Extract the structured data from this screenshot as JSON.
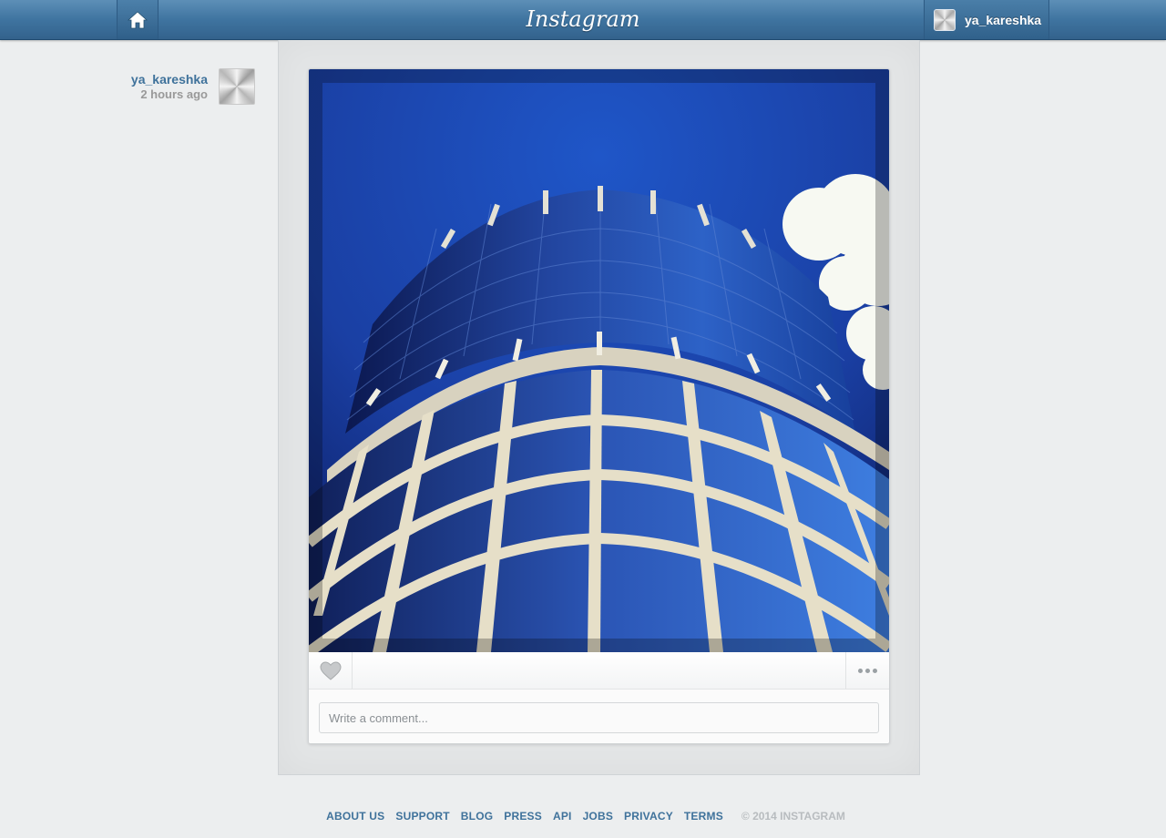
{
  "header": {
    "logo_text": "Instagram",
    "username": "ya_kareshka",
    "home_icon": "home-icon"
  },
  "post": {
    "username": "ya_kareshka",
    "time_ago": "2 hours ago",
    "photo_description": "building",
    "like_icon": "heart-icon",
    "more_icon": "ellipsis-icon",
    "comment_placeholder": "Write a comment..."
  },
  "footer": {
    "links": [
      "ABOUT US",
      "SUPPORT",
      "BLOG",
      "PRESS",
      "API",
      "JOBS",
      "PRIVACY",
      "TERMS"
    ],
    "copyright": "© 2014 INSTAGRAM"
  },
  "colors": {
    "nav_bar": "#3f74a0",
    "link_blue": "#3f729b",
    "page_bg": "#eceeef"
  }
}
